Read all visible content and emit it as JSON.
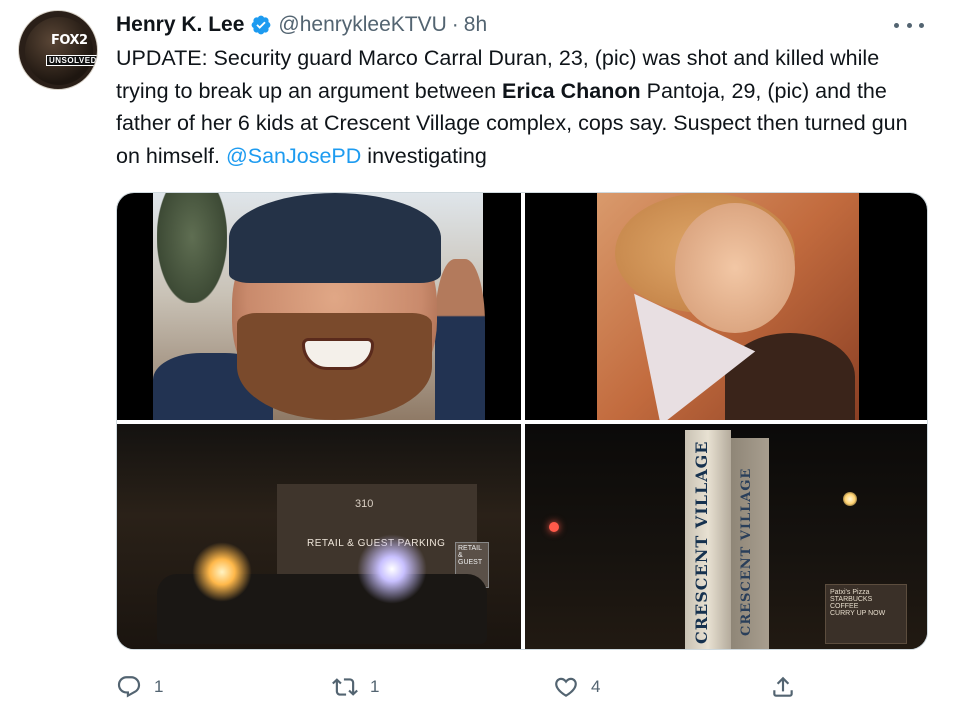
{
  "author": {
    "name": "Henry K. Lee",
    "handle": "@henrykleeKTVU",
    "separator": "·",
    "time": "8h",
    "avatar": {
      "logo_text": "FOX2",
      "tag_text": "UNSOLVED"
    }
  },
  "tweet": {
    "text_part1": "UPDATE: Security guard Marco Carral Duran, 23, (pic) was shot and killed while trying to break up an argument between ",
    "text_bold": "Erica Chanon",
    "text_part2": " Pantoja, 29, (pic) and the father of her 6 kids at Crescent Village complex, cops say. Suspect then turned gun on himself. ",
    "mention": "@SanJosePD",
    "text_part3": " investigating"
  },
  "media": {
    "photo3_sign_number": "310",
    "photo3_banner": "RETAIL & GUEST PARKING",
    "photo3_small_sign": "RETAIL & GUEST",
    "photo4_pillar_text": "CRESCENT VILLAGE",
    "photo4_pillar_text_side": "CRESCENT VILLAGE",
    "photo4_store_name": "Patxi's Pizza",
    "photo4_store_sub1": "STARBUCKS COFFEE",
    "photo4_store_sub2": "CURRY UP NOW"
  },
  "actions": {
    "reply_count": "1",
    "retweet_count": "1",
    "like_count": "4",
    "share_count": ""
  },
  "colors": {
    "accent": "#1d9bf0",
    "text": "#0f1419",
    "secondary": "#536471"
  }
}
